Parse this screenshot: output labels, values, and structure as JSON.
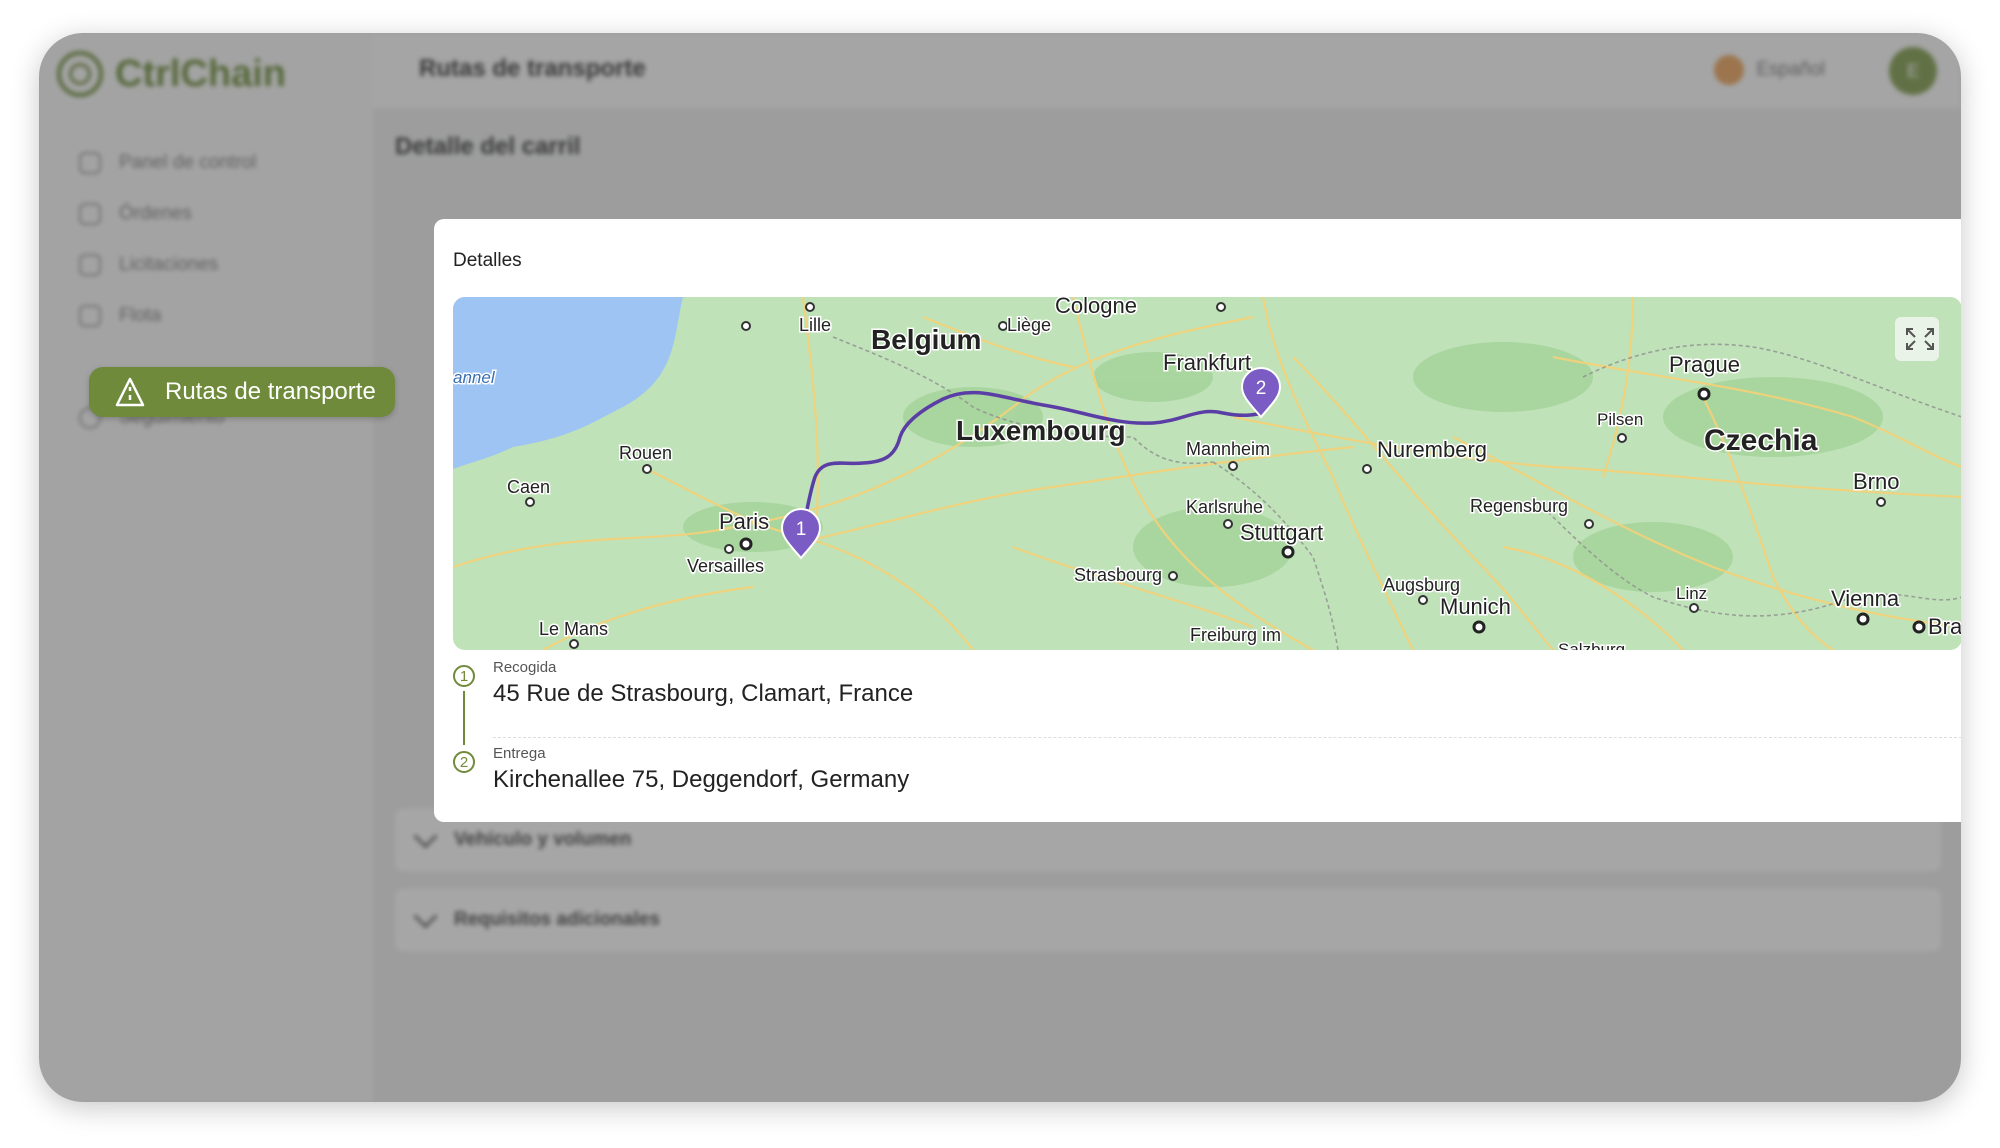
{
  "app": {
    "logo_text": "CtrlChain"
  },
  "topbar": {
    "page_title": "Rutas de transporte",
    "language": "Español",
    "avatar_initial": "E"
  },
  "sidebar": {
    "items": [
      {
        "label": "Panel de control",
        "icon": "dashboard-icon"
      },
      {
        "label": "Órdenes",
        "icon": "clipboard-icon"
      },
      {
        "label": "Licitaciones",
        "icon": "chat-icon"
      },
      {
        "label": "Flota",
        "icon": "truck-icon"
      },
      {
        "label": "Rutas de transporte",
        "icon": "road-icon",
        "active": true
      },
      {
        "label": "Seguimiento",
        "icon": "location-pin-icon"
      }
    ]
  },
  "main": {
    "section_title": "Detalle del carril",
    "accordions": [
      {
        "label": "Vehículo y volumen"
      },
      {
        "label": "Requisitos adicionales"
      }
    ]
  },
  "modal": {
    "title": "Detalles",
    "map": {
      "country_labels": [
        "Belgium",
        "Luxembourg",
        "Czechia"
      ],
      "city_labels": [
        "Cologne",
        "Lille",
        "Liège",
        "Frankfurt",
        "Prague",
        "Pilsen",
        "Rouen",
        "Caen",
        "Paris",
        "Versailles",
        "Mannheim",
        "Nuremberg",
        "Karlsruhe",
        "Stuttgart",
        "Regensburg",
        "Brno",
        "Strasbourg",
        "Augsburg",
        "Munich",
        "Linz",
        "Vienna",
        "Le Mans",
        "Freiburg im",
        "Bra",
        "Salzburg"
      ],
      "water_label": "annel",
      "expand_icon": "fullscreen-icon",
      "markers": [
        "1",
        "2"
      ]
    },
    "stops": [
      {
        "number": "1",
        "label": "Recogida",
        "address": "45 Rue de Strasbourg, Clamart, France"
      },
      {
        "number": "2",
        "label": "Entrega",
        "address": "Kirchenallee 75, Deggendorf, Germany"
      }
    ]
  },
  "colors": {
    "accent": "#6f8a3b",
    "route": "#5b3ea5",
    "marker": "#7b5cc4",
    "land": "#bfe2b8",
    "water": "#9ec4f3"
  }
}
